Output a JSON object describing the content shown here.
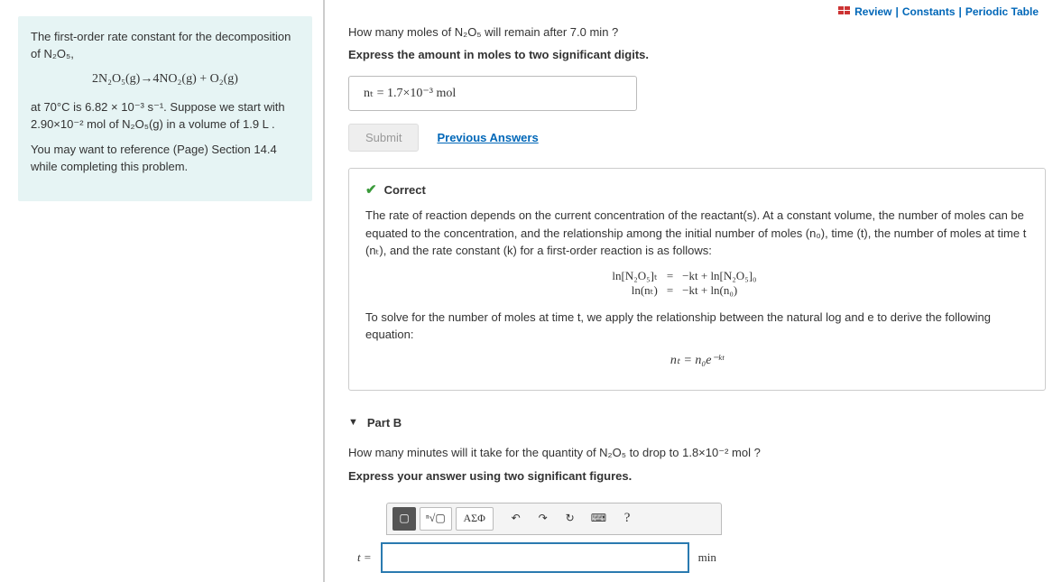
{
  "top": {
    "review": "Review",
    "constants": "Constants",
    "periodic": "Periodic Table",
    "sep": " | "
  },
  "context": {
    "p1_a": "The first-order rate constant for the decomposition of ",
    "p1_b": "N₂O₅,",
    "eqn": "2N₂O₅(g)→4NO₂(g) + O₂(g)",
    "p2_a": "at 70°C is 6.82 × 10⁻³ s⁻¹. Suppose we start with 2.90×10⁻² mol of N₂O₅(g) in a volume of 1.9 L .",
    "p3": "You may want to reference (Page) Section 14.4 while completing this problem."
  },
  "partA": {
    "q": "How many moles of N₂O₅ will remain after 7.0 min ?",
    "instr": "Express the amount in moles to two significant digits.",
    "ans_display": "nₜ =  1.7×10⁻³  mol",
    "submit": "Submit",
    "prev": "Previous Answers",
    "correct": "Correct",
    "fb1": "The rate of reaction depends on the current concentration of the reactant(s). At a constant volume, the number of moles can be equated to the concentration, and the relationship among the initial number of moles (n₀), time (t), the number of moles at time t (nₜ), and the rate constant (k) for a first-order reaction is as follows:",
    "eq1_l": "ln[N₂O₅]ₜ",
    "eq1_m": "=",
    "eq1_r": "−kt  +  ln[N₂O₅]₀",
    "eq2_l": "ln(nₜ)",
    "eq2_m": "=",
    "eq2_r": "−kt  +     ln(n₀)",
    "fb2": "To solve for the number of moles at time t, we apply the relationship between the natural log and e to derive the following equation:",
    "eq3": "nₜ = n₀e⁻ᵏᵗ"
  },
  "partB": {
    "title": "Part B",
    "q": "How many minutes will it take for the quantity of N₂O₅ to drop to 1.8×10⁻² mol ?",
    "instr": "Express your answer using two significant figures.",
    "var": "t =",
    "unit": "min",
    "tools": {
      "templates": "▢",
      "root": "ⁿ√▢",
      "greek": "ΑΣΦ",
      "undo": "↶",
      "redo": "↷",
      "reset": "↻",
      "keyboard": "⌨",
      "help": "?"
    }
  }
}
